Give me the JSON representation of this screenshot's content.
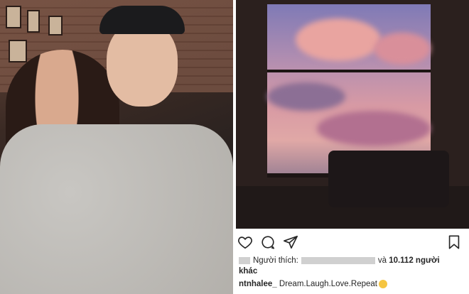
{
  "post": {
    "likes_label": "Người thích:",
    "likes_conj": "và",
    "likes_count": "10.112 người",
    "likes_suffix": "khác",
    "username": "ntnhalee_",
    "caption": "Dream.Laugh.Love.Repeat"
  },
  "icons": [
    "heart-icon",
    "comment-icon",
    "share-icon",
    "bookmark-icon"
  ]
}
